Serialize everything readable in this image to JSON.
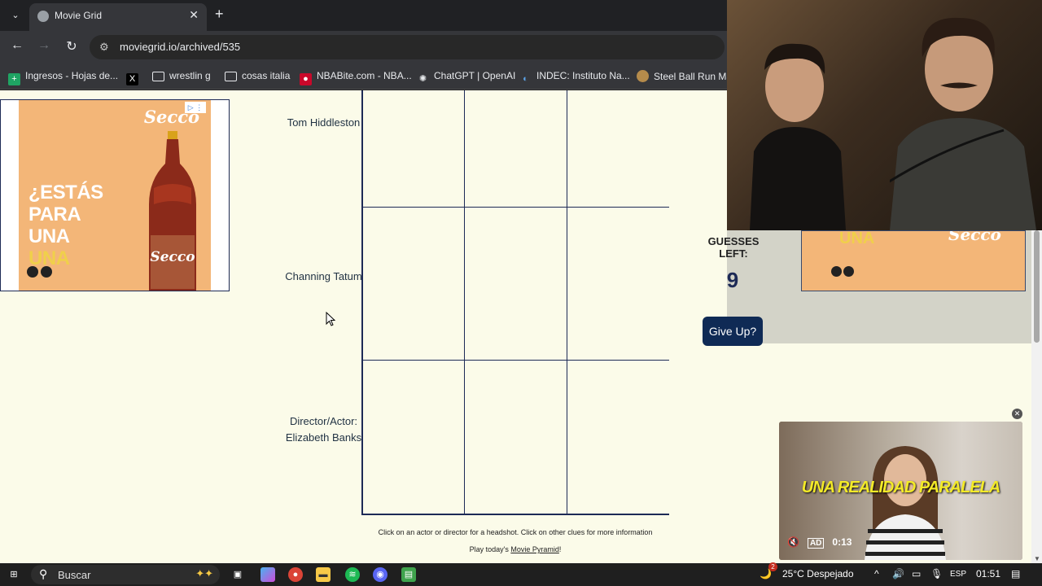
{
  "browser": {
    "tab_title": "Movie Grid",
    "url": "moviegrid.io/archived/535",
    "bookmarks": [
      {
        "label": "Ingresos - Hojas de...",
        "icon": "sheets-icon"
      },
      {
        "label": "",
        "icon": "x-icon"
      },
      {
        "label": "wrestlin g",
        "icon": "folder-icon"
      },
      {
        "label": "cosas italia",
        "icon": "folder-icon"
      },
      {
        "label": "NBABite.com - NBA...",
        "icon": "nba-icon"
      },
      {
        "label": "ChatGPT | OpenAI",
        "icon": "openai-icon"
      },
      {
        "label": "INDEC: Instituto Na...",
        "icon": "indec-icon"
      },
      {
        "label": "Steel Ball Run Man",
        "icon": "sbr-icon"
      }
    ]
  },
  "ad": {
    "brand": "Secco",
    "headline_1": "¿ESTÁS PARA",
    "headline_2": "UNA",
    "headline_3": "UNA",
    "bottle_label": "Secco",
    "accent": "#f3b678"
  },
  "grid": {
    "rows": [
      {
        "label": "Tom Hiddleston"
      },
      {
        "label": "Channing Tatum"
      },
      {
        "label": "Director/Actor: Elizabeth Banks"
      }
    ]
  },
  "hint": {
    "line1": "Click on an actor or director for a headshot. Click on other clues for more information",
    "line2_prefix": "Play today's ",
    "line2_link": "Movie Pyramid",
    "line2_suffix": "!"
  },
  "side": {
    "guesses_label": "GUESSES LEFT:",
    "guesses_left": "9",
    "give_up": "Give Up?"
  },
  "video": {
    "caption": "UNA REALIDAD PARALELA",
    "badge": "AD",
    "time": "0:13"
  },
  "taskbar": {
    "search_placeholder": "Buscar",
    "weather": "25°C  Despejado",
    "language": "ESP",
    "time": "01:51",
    "notification_count": "2"
  }
}
